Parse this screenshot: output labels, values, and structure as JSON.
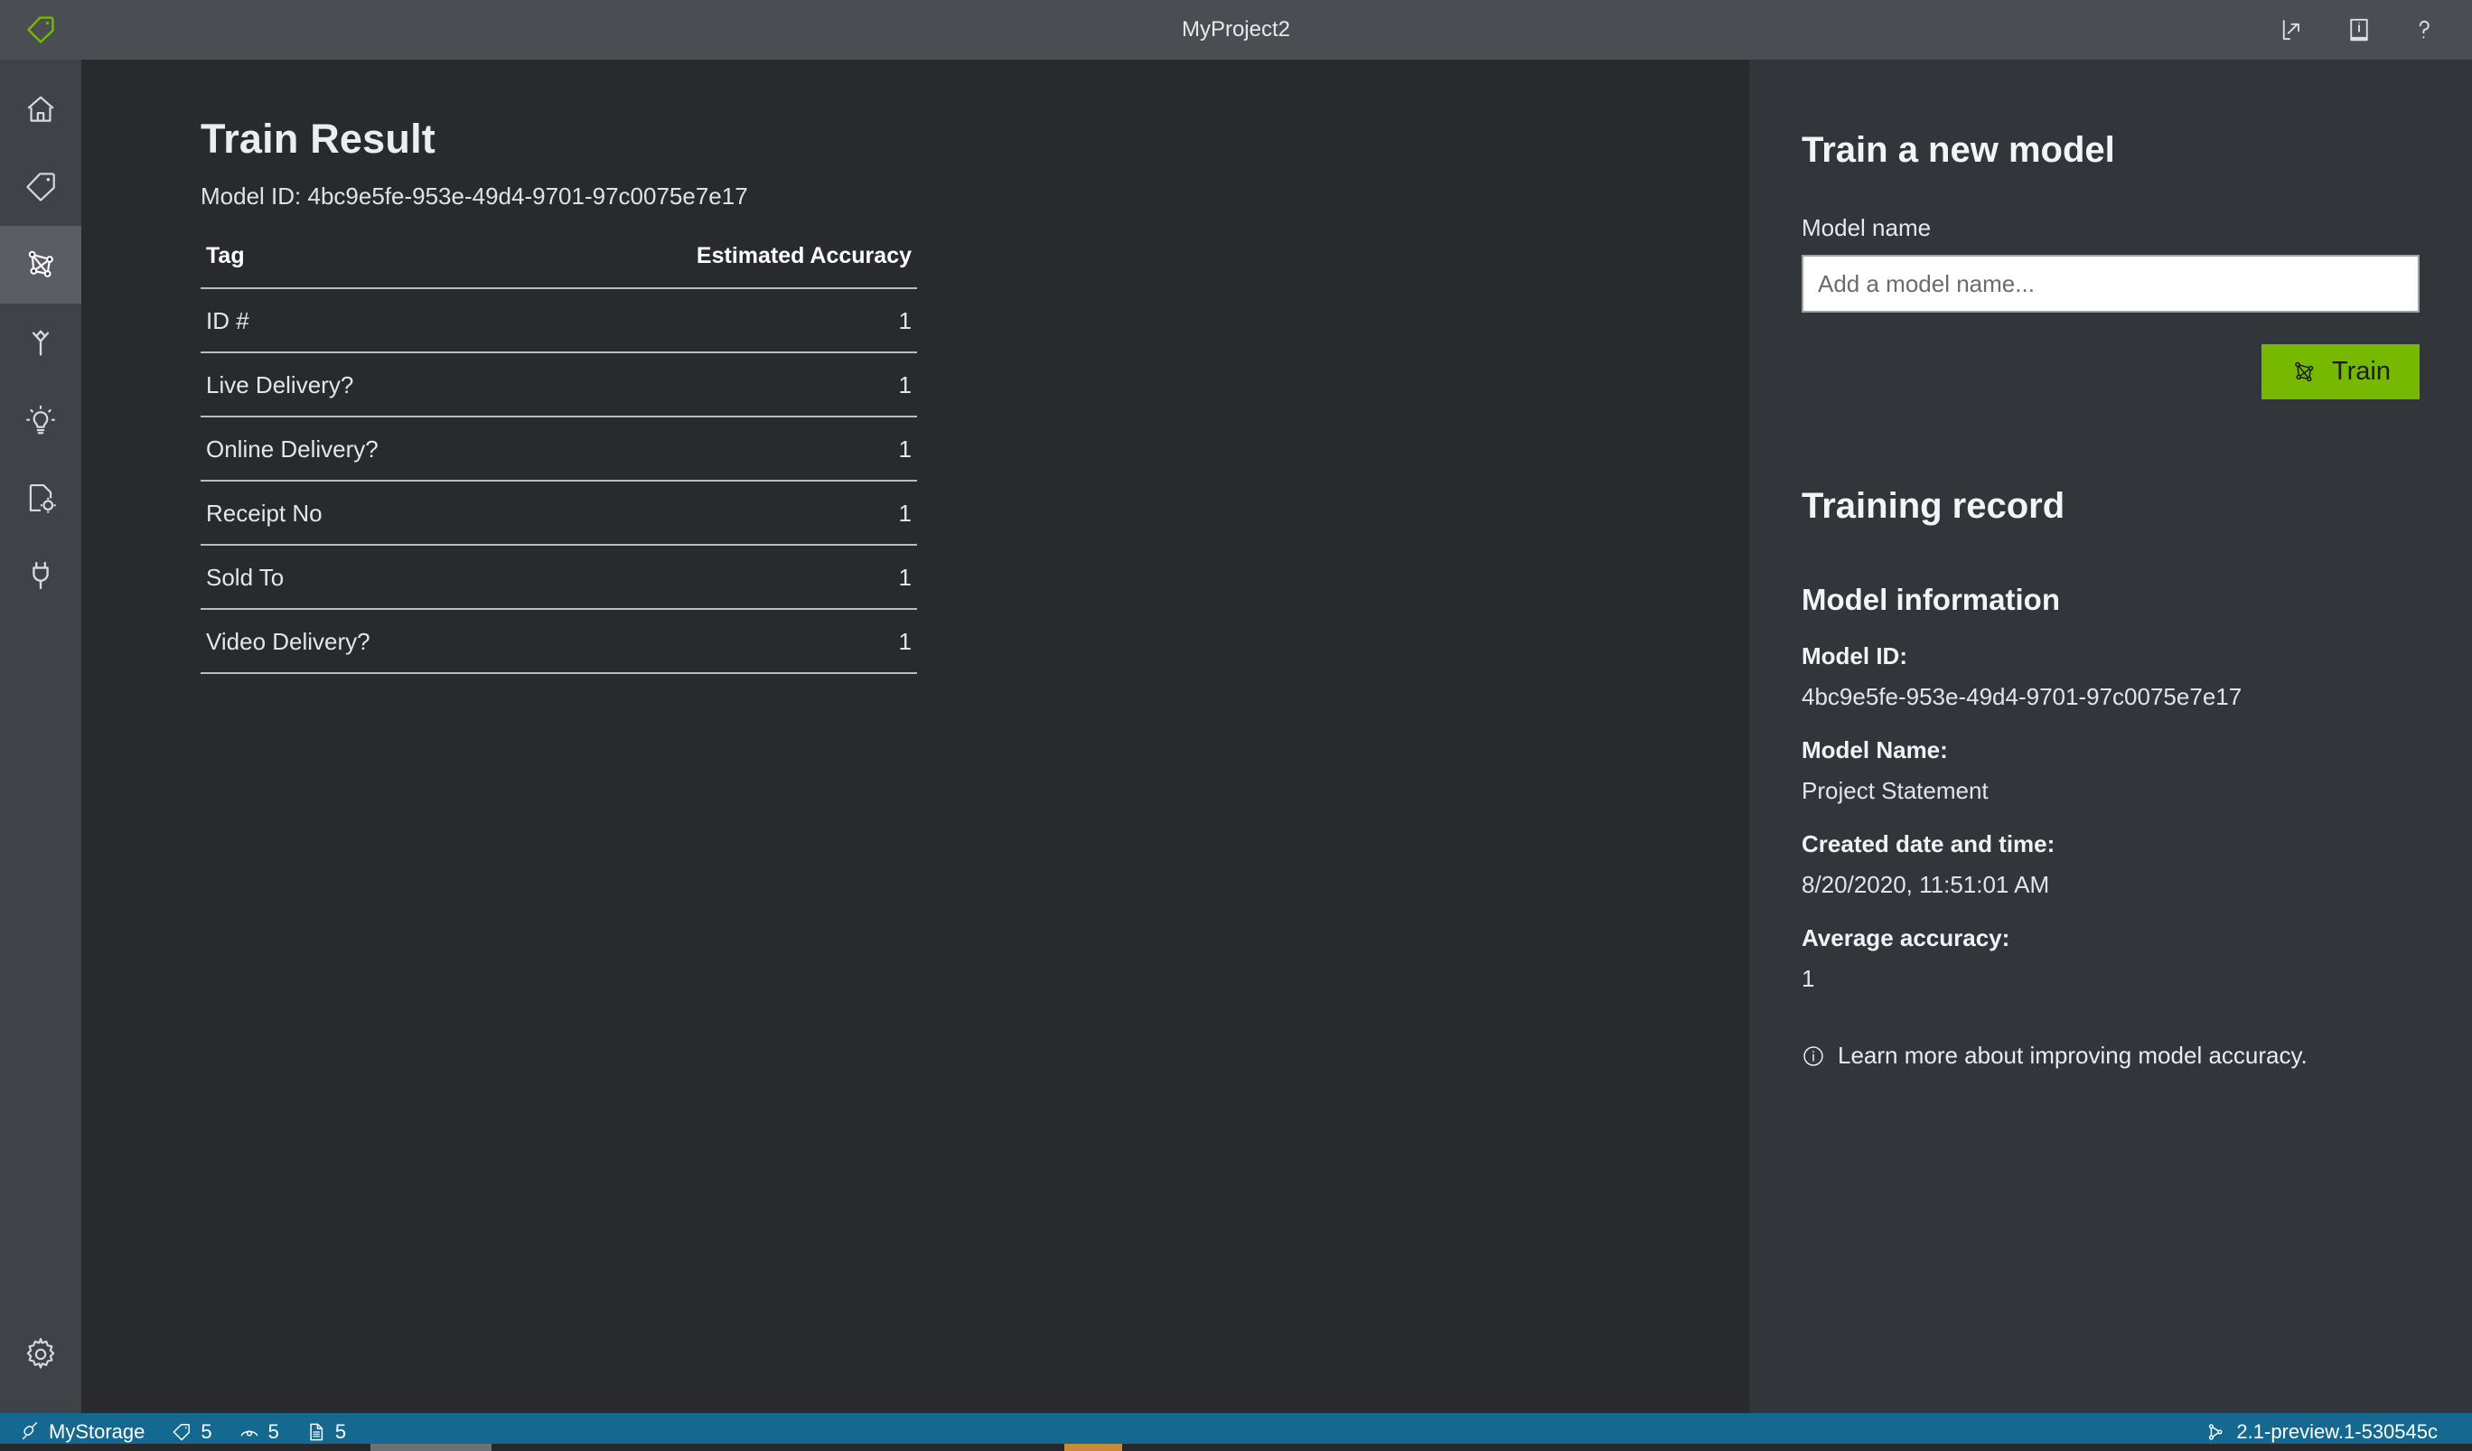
{
  "titlebar": {
    "logo_icon": "tag-icon",
    "title": "MyProject2",
    "actions": [
      {
        "name": "share-icon",
        "label": "Share"
      },
      {
        "name": "documentation-icon",
        "label": "Documentation"
      },
      {
        "name": "help-icon",
        "label": "Help"
      }
    ]
  },
  "sidebar": {
    "items": [
      {
        "icon": "home-icon",
        "label": "Home",
        "active": false
      },
      {
        "icon": "tag-icon",
        "label": "Tag Editor",
        "active": false
      },
      {
        "icon": "model-nodes-icon",
        "label": "Train",
        "active": true
      },
      {
        "icon": "compose-merge-icon",
        "label": "Compose",
        "active": false
      },
      {
        "icon": "lightbulb-icon",
        "label": "Analyze",
        "active": false
      },
      {
        "icon": "document-settings-icon",
        "label": "Model Compose",
        "active": false
      },
      {
        "icon": "plug-icon",
        "label": "Connections",
        "active": false
      }
    ],
    "settings": {
      "icon": "gear-icon",
      "label": "Application Settings"
    }
  },
  "main": {
    "page_title": "Train Result",
    "model_id_line": "Model ID: 4bc9e5fe-953e-49d4-9701-97c0075e7e17",
    "table": {
      "columns": [
        "Tag",
        "Estimated Accuracy"
      ],
      "rows": [
        {
          "tag": "ID #",
          "accuracy": "1"
        },
        {
          "tag": "Live Delivery?",
          "accuracy": "1"
        },
        {
          "tag": "Online Delivery?",
          "accuracy": "1"
        },
        {
          "tag": "Receipt No",
          "accuracy": "1"
        },
        {
          "tag": "Sold To",
          "accuracy": "1"
        },
        {
          "tag": "Video Delivery?",
          "accuracy": "1"
        }
      ]
    }
  },
  "right": {
    "heading": "Train a new model",
    "model_name_label": "Model name",
    "model_name_value": "",
    "model_name_placeholder": "Add a model name...",
    "train_button": "Train",
    "train_button_color": "#76b900",
    "training_record_heading": "Training record",
    "model_information_heading": "Model information",
    "info": [
      {
        "key": "Model ID:",
        "value": "4bc9e5fe-953e-49d4-9701-97c0075e7e17"
      },
      {
        "key": "Model Name:",
        "value": "Project Statement"
      },
      {
        "key": "Created date and time:",
        "value": "8/20/2020, 11:51:01 AM"
      },
      {
        "key": "Average accuracy:",
        "value": "1"
      }
    ],
    "learn_more": "Learn more about improving model accuracy."
  },
  "statusbar": {
    "background": "#15688f",
    "connection": "MyStorage",
    "counts": [
      {
        "icon": "tag-icon",
        "value": "5"
      },
      {
        "icon": "eye-icon",
        "value": "5"
      },
      {
        "icon": "document-icon",
        "value": "5"
      }
    ],
    "version": "2.1-preview.1-530545c"
  }
}
